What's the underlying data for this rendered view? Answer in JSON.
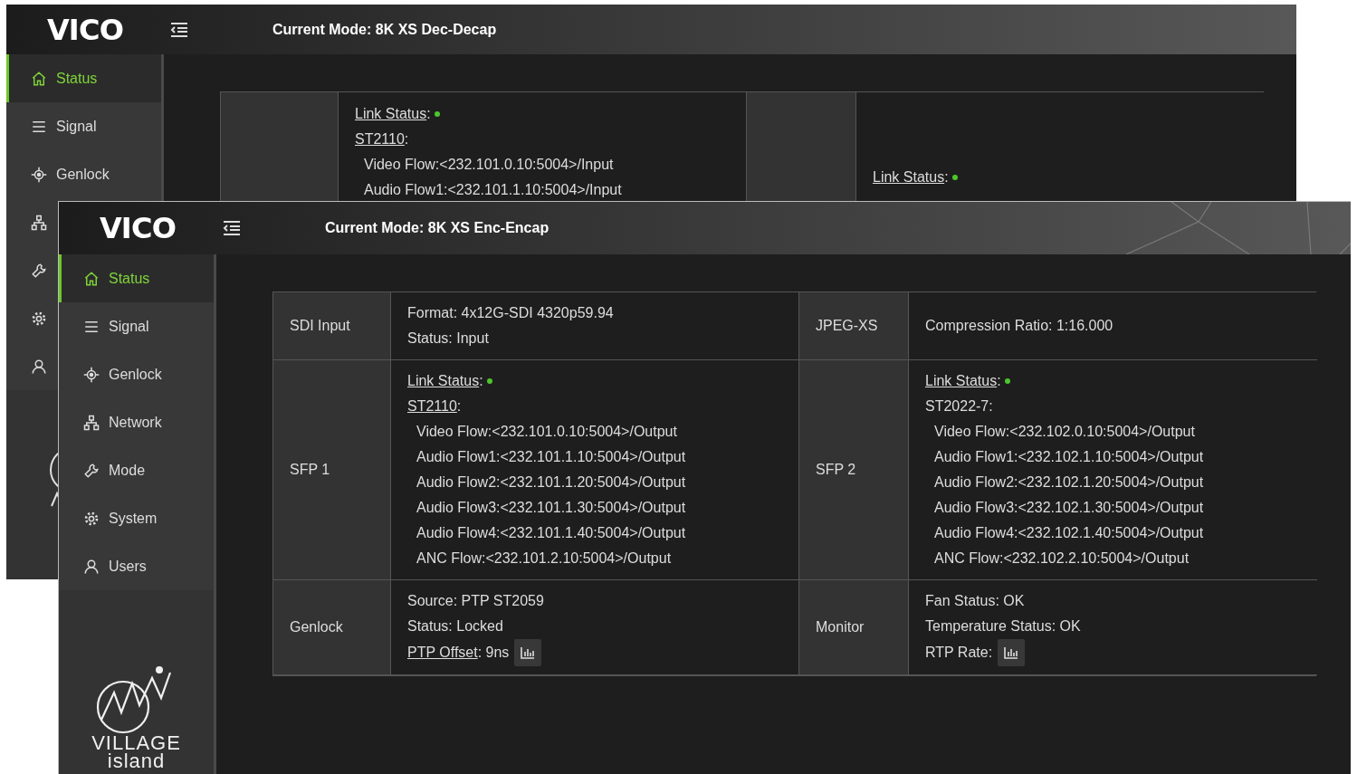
{
  "windows": [
    {
      "kind": "back",
      "logo": "VICO",
      "title": "Current Mode: 8K XS Dec-Decap",
      "sidebar": {
        "items": [
          {
            "label": "Status",
            "selected": true
          },
          {
            "label": "Signal",
            "selected": false
          },
          {
            "label": "Genlock",
            "selected": false
          },
          {
            "selected": false
          },
          {
            "selected": false
          },
          {
            "selected": false
          },
          {
            "selected": false
          }
        ]
      },
      "panels": [
        {
          "lines": [
            {
              "kind": "link",
              "label": "Link Status",
              "text": ":",
              "color": "#4cc72a"
            },
            {
              "kind": "link",
              "label": "ST2110",
              "text": ":"
            },
            {
              "kind": "indent",
              "text": "Video Flow:<232.101.0.10:5004>/Input"
            },
            {
              "kind": "indent",
              "text": "Audio Flow1:<232.101.1.10:5004>/Input"
            }
          ]
        },
        {
          "lines": [
            {
              "kind": "link",
              "label": "Link Status",
              "text": ":",
              "color": "#4cc72a"
            }
          ]
        }
      ]
    },
    {
      "kind": "front",
      "logo": "VICO",
      "title": "Current Mode: 8K XS Enc-Encap",
      "sidebar": {
        "items": [
          {
            "label": "Status",
            "selected": true
          },
          {
            "label": "Signal",
            "selected": false
          },
          {
            "label": "Genlock",
            "selected": false
          },
          {
            "label": "Network",
            "selected": false
          },
          {
            "label": "Mode",
            "selected": false
          },
          {
            "label": "System",
            "selected": false
          },
          {
            "label": "Users",
            "selected": false
          }
        ]
      },
      "brand": [
        "VILLAGE",
        "island"
      ],
      "panels": [
        {
          "label": "SDI Input",
          "lines": [
            {
              "kind": "plain",
              "text": "Format: 4x12G-SDI 4320p59.94"
            },
            {
              "kind": "plain",
              "text": "Status: Input"
            }
          ]
        },
        {
          "label": "JPEG-XS",
          "lines": [
            {
              "kind": "plain",
              "text": "Compression Ratio: 1:16.000"
            }
          ]
        },
        {
          "label": "SFP 1",
          "lines": [
            {
              "kind": "link",
              "label": "Link Status",
              "text": ":",
              "color": "#4cc72a"
            },
            {
              "kind": "link",
              "label": "ST2110",
              "text": ":"
            },
            {
              "kind": "indent",
              "text": "Video Flow:<232.101.0.10:5004>/Output"
            },
            {
              "kind": "indent",
              "text": "Audio Flow1:<232.101.1.10:5004>/Output"
            },
            {
              "kind": "indent",
              "text": "Audio Flow2:<232.101.1.20:5004>/Output"
            },
            {
              "kind": "indent",
              "text": "Audio Flow3:<232.101.1.30:5004>/Output"
            },
            {
              "kind": "indent",
              "text": "Audio Flow4:<232.101.1.40:5004>/Output"
            },
            {
              "kind": "indent",
              "text": "ANC Flow:<232.101.2.10:5004>/Output"
            }
          ]
        },
        {
          "label": "SFP 2",
          "lines": [
            {
              "kind": "link",
              "label": "Link Status",
              "text": ":",
              "color": "#4cc72a"
            },
            {
              "kind": "plain",
              "text": "ST2022-7:"
            },
            {
              "kind": "indent",
              "text": "Video Flow:<232.102.0.10:5004>/Output"
            },
            {
              "kind": "indent",
              "text": "Audio Flow1:<232.102.1.10:5004>/Output"
            },
            {
              "kind": "indent",
              "text": "Audio Flow2:<232.102.1.20:5004>/Output"
            },
            {
              "kind": "indent",
              "text": "Audio Flow3:<232.102.1.30:5004>/Output"
            },
            {
              "kind": "indent",
              "text": "Audio Flow4:<232.102.1.40:5004>/Output"
            },
            {
              "kind": "indent",
              "text": "ANC Flow:<232.102.2.10:5004>/Output"
            }
          ]
        },
        {
          "label": "Genlock",
          "lines": [
            {
              "kind": "plain",
              "text": "Source: PTP ST2059"
            },
            {
              "kind": "plain",
              "text": "Status: Locked"
            },
            {
              "kind": "link",
              "label": "PTP Offset",
              "text": ": 9ns",
              "chart_button": true
            }
          ]
        },
        {
          "label": "Monitor",
          "lines": [
            {
              "kind": "plain",
              "text": "Fan Status: OK"
            },
            {
              "kind": "plain",
              "text": "Temperature Status: OK"
            },
            {
              "kind": "plain",
              "text": "RTP Rate:",
              "chart_button": true
            }
          ]
        }
      ]
    }
  ]
}
